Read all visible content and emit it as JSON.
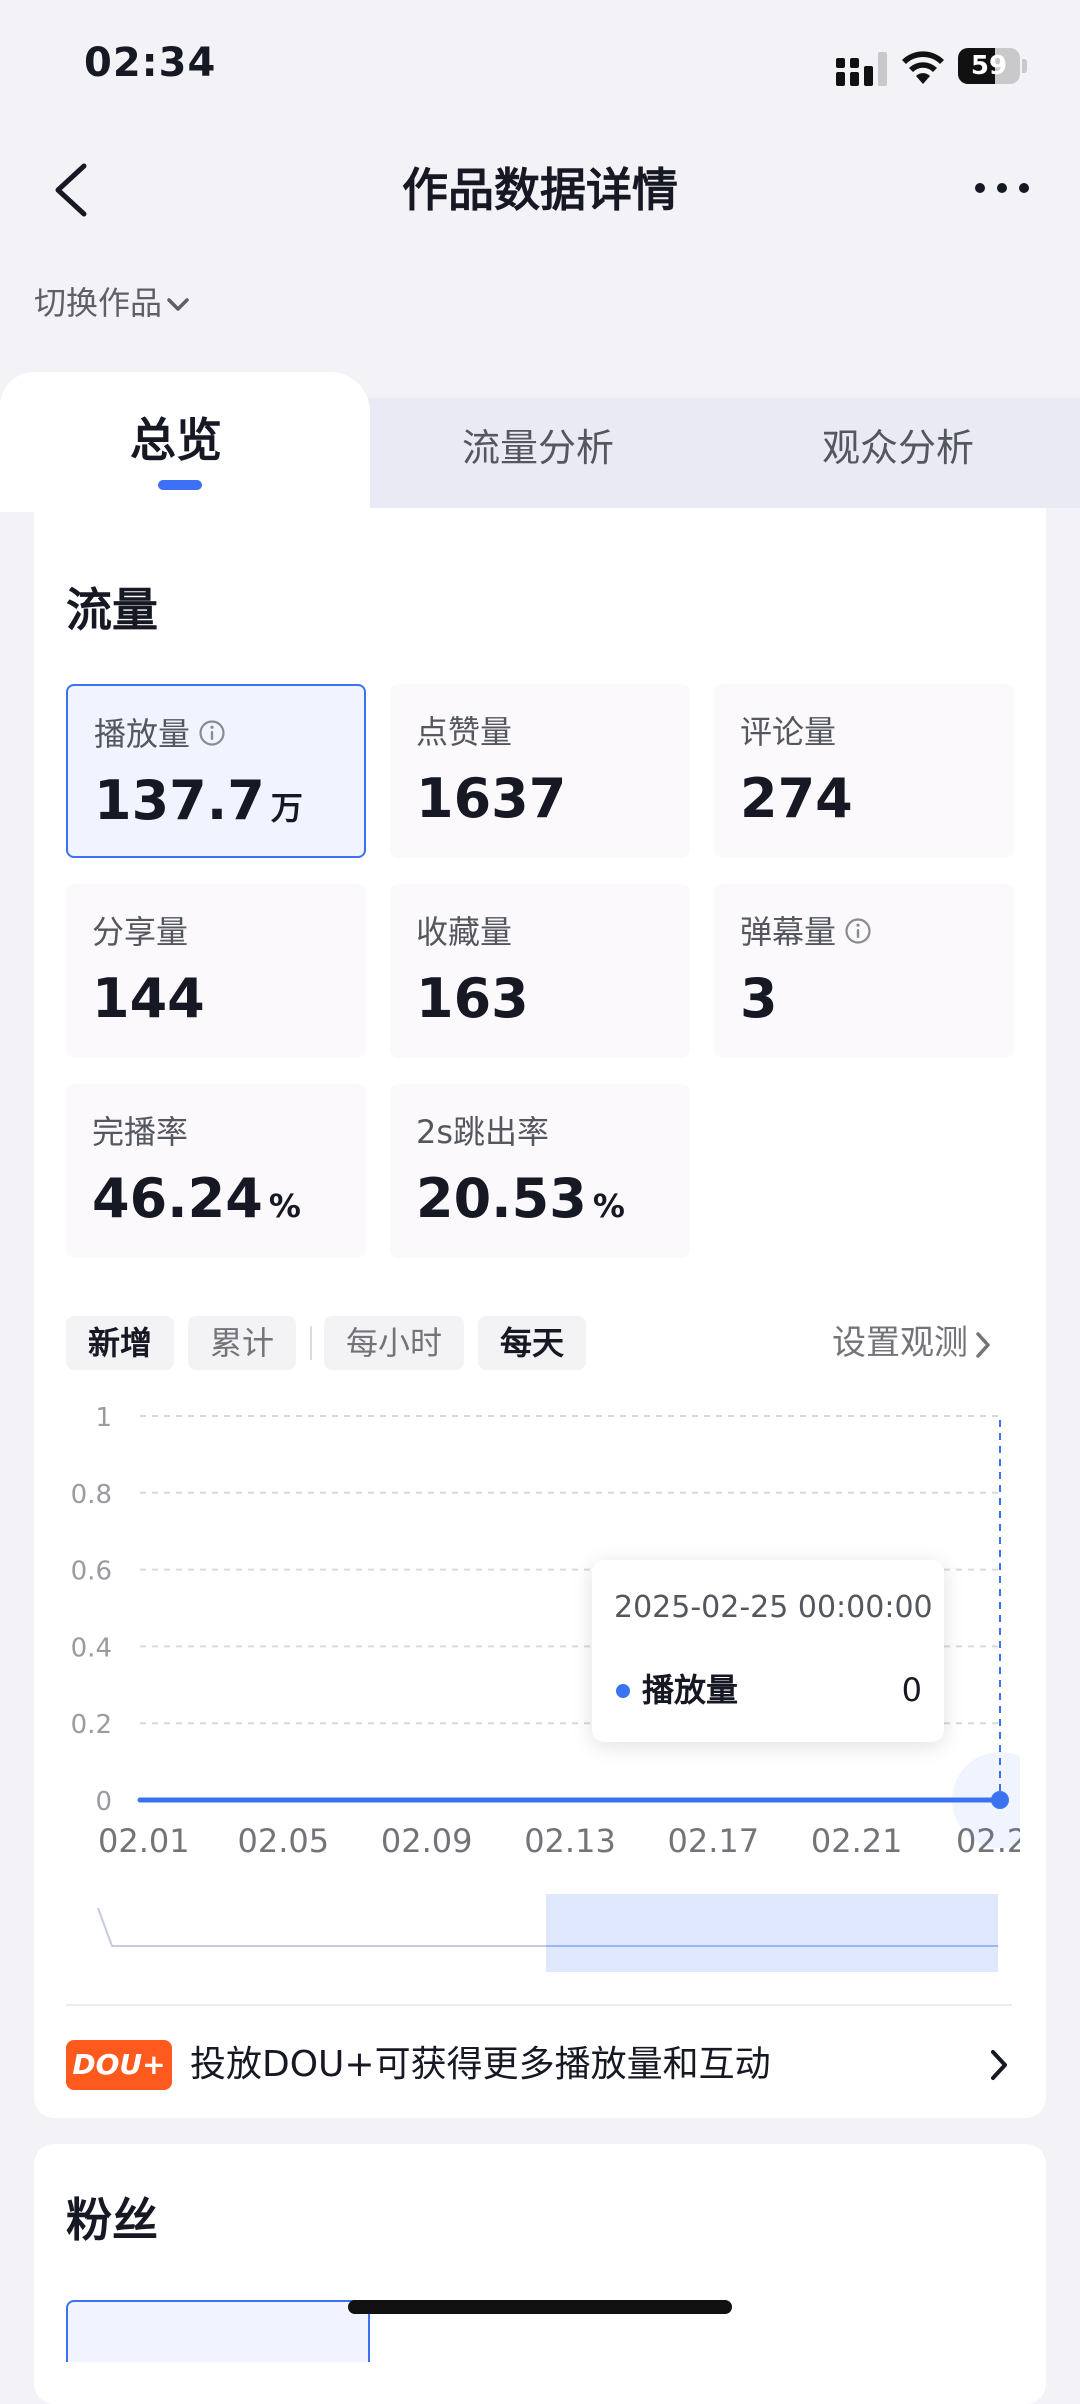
{
  "status": {
    "time": "02:34",
    "battery": "59",
    "battery_level": 0.59
  },
  "nav": {
    "title": "作品数据详情",
    "switch_label": "切换作品"
  },
  "tabs": [
    {
      "label": "总览",
      "active": true
    },
    {
      "label": "流量分析",
      "active": false
    },
    {
      "label": "观众分析",
      "active": false
    }
  ],
  "traffic": {
    "title": "流量",
    "metrics": [
      {
        "label": "播放量",
        "value": "137.7",
        "unit": "万",
        "info": true,
        "selected": true
      },
      {
        "label": "点赞量",
        "value": "1637",
        "unit": ""
      },
      {
        "label": "评论量",
        "value": "274",
        "unit": ""
      },
      {
        "label": "分享量",
        "value": "144",
        "unit": ""
      },
      {
        "label": "收藏量",
        "value": "163",
        "unit": ""
      },
      {
        "label": "弹幕量",
        "value": "3",
        "unit": "",
        "info": true
      },
      {
        "label": "完播率",
        "value": "46.24",
        "unit": "%"
      },
      {
        "label": "2s跳出率",
        "value": "20.53",
        "unit": "%"
      }
    ]
  },
  "chips": {
    "added": "新增",
    "cumulative": "累计",
    "hourly": "每小时",
    "daily": "每天"
  },
  "observe_label": "设置观测",
  "chart_data": {
    "type": "line",
    "x": [
      "02.01",
      "02.02",
      "02.03",
      "02.04",
      "02.05",
      "02.06",
      "02.07",
      "02.08",
      "02.09",
      "02.10",
      "02.11",
      "02.12",
      "02.13",
      "02.14",
      "02.15",
      "02.16",
      "02.17",
      "02.18",
      "02.19",
      "02.20",
      "02.21",
      "02.22",
      "02.23",
      "02.24",
      "02.25"
    ],
    "x_ticks": [
      "02.01",
      "02.05",
      "02.09",
      "02.13",
      "02.17",
      "02.21",
      "02.2"
    ],
    "y_ticks": [
      "0",
      "0.2",
      "0.4",
      "0.6",
      "0.8",
      "1"
    ],
    "ylim": [
      0,
      1
    ],
    "series": [
      {
        "name": "播放量",
        "values": [
          0,
          0,
          0,
          0,
          0,
          0,
          0,
          0,
          0,
          0,
          0,
          0,
          0,
          0,
          0,
          0,
          0,
          0,
          0,
          0,
          0,
          0,
          0,
          0,
          0
        ]
      }
    ],
    "grid": true,
    "line_color": "#3a72f0"
  },
  "tooltip": {
    "time": "2025-02-25 00:00:00",
    "series": "播放量",
    "value": "0"
  },
  "promo": {
    "logo": "DOU+",
    "text": "投放DOU+可获得更多播放量和互动"
  },
  "fans": {
    "title": "粉丝"
  }
}
